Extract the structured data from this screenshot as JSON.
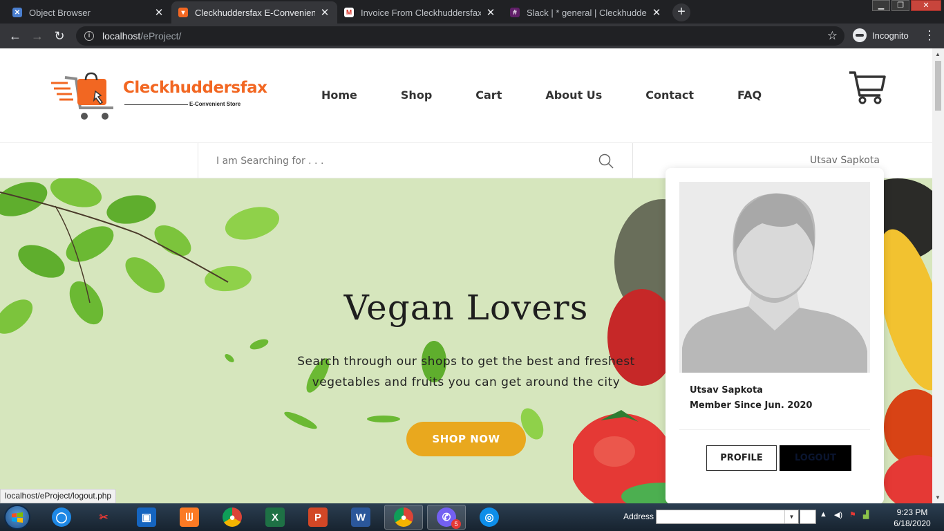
{
  "browser": {
    "tabs": [
      {
        "title": "Object Browser",
        "favicon_color": "#4a7fd0"
      },
      {
        "title": "Cleckhuddersfax E-Convenient St",
        "favicon_color": "#f26722"
      },
      {
        "title": "Invoice From Cleckhuddersfax - u",
        "favicon_color": "#d93025"
      },
      {
        "title": "Slack | * general | Cleckhuddersfa",
        "favicon_color": "#611f69"
      }
    ],
    "active_tab_index": 1,
    "url_host": "localhost",
    "url_path": "/eProject/",
    "incognito_label": "Incognito",
    "status_url": "localhost/eProject/logout.php"
  },
  "site": {
    "brand": "Cleckhuddersfax",
    "tagline": "E-Convenient Store",
    "nav": [
      {
        "label": "Home"
      },
      {
        "label": "Shop"
      },
      {
        "label": "Cart"
      },
      {
        "label": "About Us"
      },
      {
        "label": "Contact"
      },
      {
        "label": "FAQ"
      }
    ],
    "search": {
      "placeholder": "I am Searching for . . ."
    },
    "user_name": "Utsav Sapkota",
    "hero": {
      "title": "Vegan Lovers",
      "subtitle": "Search through our shops to get the best and freshest vegetables and fruits you can get around the city",
      "cta": "SHOP NOW"
    },
    "profile_menu": {
      "name": "Utsav Sapkota",
      "member_since": "Member Since Jun. 2020",
      "profile_button": "PROFILE",
      "logout_button": "LOGOUT"
    },
    "colors": {
      "brand_orange": "#f26722",
      "cta_yellow": "#e9a81e",
      "hero_bg": "#d6e6bd"
    }
  },
  "taskbar": {
    "address_label": "Address",
    "time": "9:23 PM",
    "date": "6/18/2020",
    "viber_badge": "5",
    "apps": [
      "ie-icon",
      "snipping-icon",
      "virtualbox-icon",
      "xampp-icon",
      "chrome-icon",
      "excel-icon",
      "powerpoint-icon",
      "word-icon",
      "chrome-active-icon",
      "viber-icon",
      "teamviewer-icon"
    ]
  }
}
